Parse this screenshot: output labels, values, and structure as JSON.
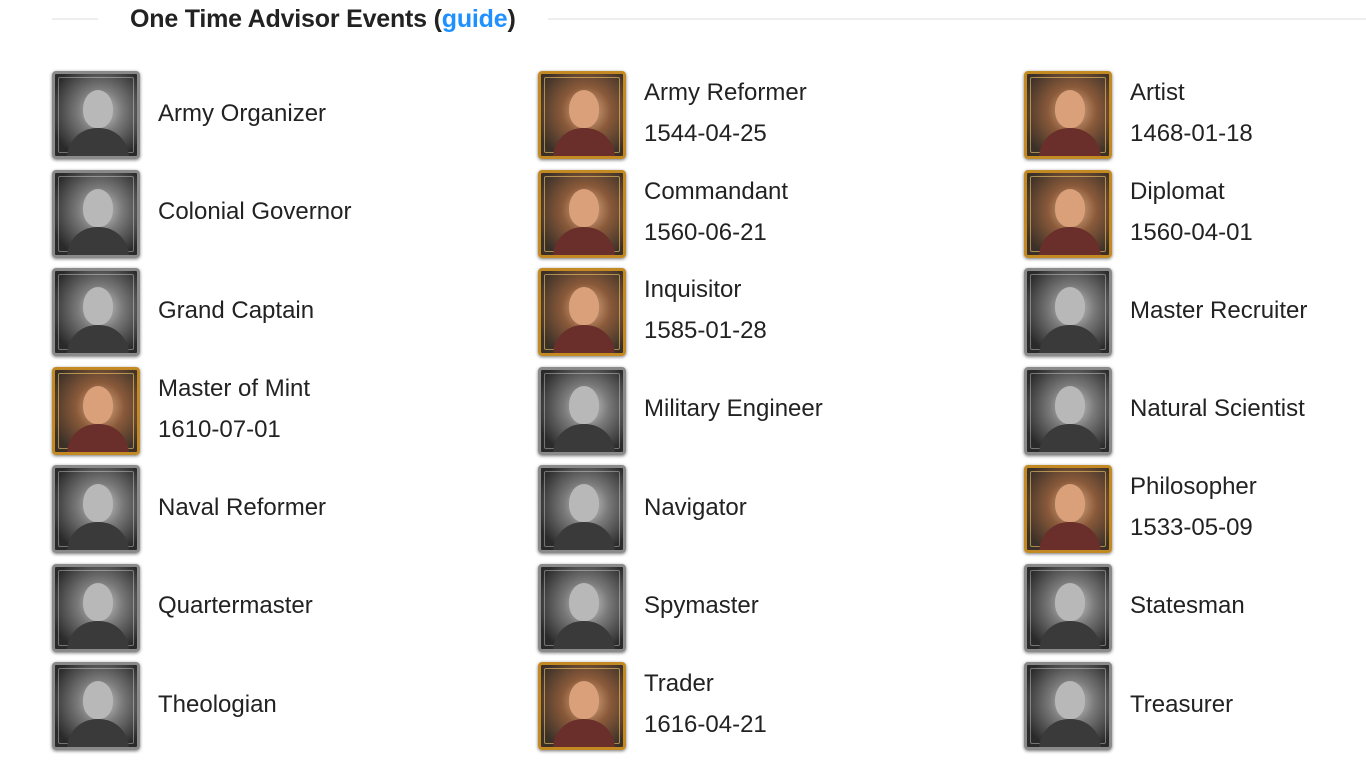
{
  "header": {
    "title": "One Time Advisor Events",
    "open_paren": " (",
    "link_label": "guide",
    "close_paren": ")"
  },
  "colors": {
    "link": "#1e90ff",
    "text": "#222222",
    "frame_gold": "#c38a24",
    "frame_gray": "#8a8a8a"
  },
  "advisors": [
    {
      "name": "Army Organizer",
      "date": "",
      "frame": "gray",
      "icon": "army-organizer-portrait-icon"
    },
    {
      "name": "Army Reformer",
      "date": "1544-04-25",
      "frame": "gold",
      "icon": "army-reformer-portrait-icon"
    },
    {
      "name": "Artist",
      "date": "1468-01-18",
      "frame": "gold",
      "icon": "artist-portrait-icon"
    },
    {
      "name": "Colonial Governor",
      "date": "",
      "frame": "gray",
      "icon": "colonial-governor-portrait-icon"
    },
    {
      "name": "Commandant",
      "date": "1560-06-21",
      "frame": "gold",
      "icon": "commandant-portrait-icon"
    },
    {
      "name": "Diplomat",
      "date": "1560-04-01",
      "frame": "gold",
      "icon": "diplomat-portrait-icon"
    },
    {
      "name": "Grand Captain",
      "date": "",
      "frame": "gray",
      "icon": "grand-captain-portrait-icon"
    },
    {
      "name": "Inquisitor",
      "date": "1585-01-28",
      "frame": "gold",
      "icon": "inquisitor-portrait-icon"
    },
    {
      "name": "Master Recruiter",
      "date": "",
      "frame": "gray",
      "icon": "master-recruiter-portrait-icon"
    },
    {
      "name": "Master of Mint",
      "date": "1610-07-01",
      "frame": "gold",
      "icon": "master-of-mint-portrait-icon"
    },
    {
      "name": "Military Engineer",
      "date": "",
      "frame": "gray",
      "icon": "military-engineer-portrait-icon"
    },
    {
      "name": "Natural Scientist",
      "date": "",
      "frame": "gray",
      "icon": "natural-scientist-portrait-icon"
    },
    {
      "name": "Naval Reformer",
      "date": "",
      "frame": "gray",
      "icon": "naval-reformer-portrait-icon"
    },
    {
      "name": "Navigator",
      "date": "",
      "frame": "gray",
      "icon": "navigator-portrait-icon"
    },
    {
      "name": "Philosopher",
      "date": "1533-05-09",
      "frame": "gold",
      "icon": "philosopher-portrait-icon"
    },
    {
      "name": "Quartermaster",
      "date": "",
      "frame": "gray",
      "icon": "quartermaster-portrait-icon"
    },
    {
      "name": "Spymaster",
      "date": "",
      "frame": "gray",
      "icon": "spymaster-portrait-icon"
    },
    {
      "name": "Statesman",
      "date": "",
      "frame": "gray",
      "icon": "statesman-portrait-icon"
    },
    {
      "name": "Theologian",
      "date": "",
      "frame": "gray",
      "icon": "theologian-portrait-icon"
    },
    {
      "name": "Trader",
      "date": "1616-04-21",
      "frame": "gold",
      "icon": "trader-portrait-icon"
    },
    {
      "name": "Treasurer",
      "date": "",
      "frame": "gray",
      "icon": "treasurer-portrait-icon"
    }
  ]
}
